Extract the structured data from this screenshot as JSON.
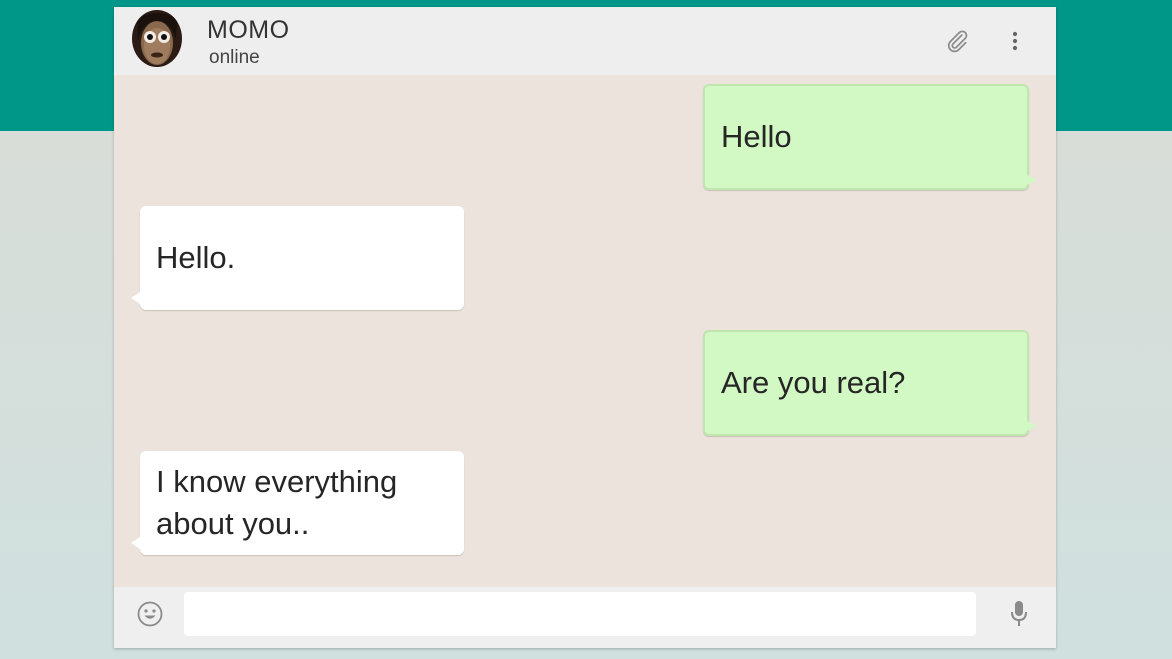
{
  "app": {
    "accent_color": "#009688",
    "outgoing_bubble_color": "#d2f8c4",
    "incoming_bubble_color": "#ffffff",
    "chat_background_color": "#ece4dc"
  },
  "header": {
    "contact_name": "MOMO",
    "status": "online",
    "avatar_icon": "avatar-image",
    "actions": [
      {
        "icon": "paperclip-icon"
      },
      {
        "icon": "more-vertical-icon"
      }
    ]
  },
  "messages": [
    {
      "direction": "outgoing",
      "text": "Hello"
    },
    {
      "direction": "incoming",
      "text": "Hello."
    },
    {
      "direction": "outgoing",
      "text": "Are you real?"
    },
    {
      "direction": "incoming",
      "lines": [
        "I know everything",
        "about you.."
      ]
    }
  ],
  "composer": {
    "value": "",
    "placeholder": "",
    "emoji_icon": "emoji-icon",
    "mic_icon": "microphone-icon"
  }
}
